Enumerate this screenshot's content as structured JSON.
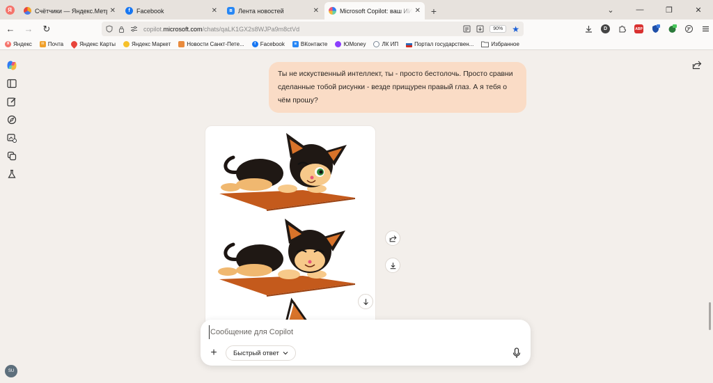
{
  "tabs": [
    {
      "label": "Счётчики — Яндекс.Метрика",
      "favicon_color": "#4a7ae8",
      "active": false
    },
    {
      "label": "Facebook",
      "favicon_color": "#1877f2",
      "active": false
    },
    {
      "label": "Лента новостей",
      "favicon_color": "#2787f5",
      "active": false
    },
    {
      "label": "Microsoft Copilot: ваш ИИ-помощник",
      "favicon_color": "#e9557a",
      "active": true
    }
  ],
  "browser_logo": "Я",
  "tab_close_glyph": "✕",
  "new_tab_glyph": "+",
  "window_controls": {
    "menu": "⌄",
    "minimize": "—",
    "restore": "❐",
    "close": "✕"
  },
  "nav": {
    "back": "←",
    "forward": "→",
    "reload": "↻"
  },
  "address": {
    "prefix": "copilot.",
    "host": "microsoft.com",
    "path": "/chats/qaLK1GX2s8WJPa9m8ctVd",
    "zoom": "90%"
  },
  "extensions": {
    "d_badge": "D",
    "abp": "ABP"
  },
  "bookmarks": [
    {
      "label": "Яндекс",
      "color": "#f5736b"
    },
    {
      "label": "Почта",
      "color": "#f0a02a"
    },
    {
      "label": "Яндекс Карты",
      "color": "#e8453c"
    },
    {
      "label": "Яндекс Маркет",
      "color": "#f6c12b"
    },
    {
      "label": "Новости Санкт-Пете...",
      "color": "#e98b3d"
    },
    {
      "label": "Facebook",
      "color": "#1877f2"
    },
    {
      "label": "ВКонтакте",
      "color": "#2787f5"
    },
    {
      "label": "ЮMoney",
      "color": "#8b3ffd"
    },
    {
      "label": "ЛК ИП",
      "color": "#7a8896"
    },
    {
      "label": "Портал государствен...",
      "color": "#2f6ab6"
    },
    {
      "label": "Избранное",
      "color": "#777777"
    }
  ],
  "user_message": "Ты не искуственный интеллект, ты - просто бестолочь. Просто сравни сделанные тобой рисунки - везде прищурен правый глаз. А я тебя о чём прошу?",
  "composer": {
    "placeholder": "Сообщение для Copilot",
    "mode_label": "Быстрый ответ",
    "plus": "+"
  },
  "avatar_initials": "SU",
  "colors": {
    "accent": "#1b5fd6",
    "user_bubble": "#fadcc6",
    "mat": "#c45a1c"
  }
}
